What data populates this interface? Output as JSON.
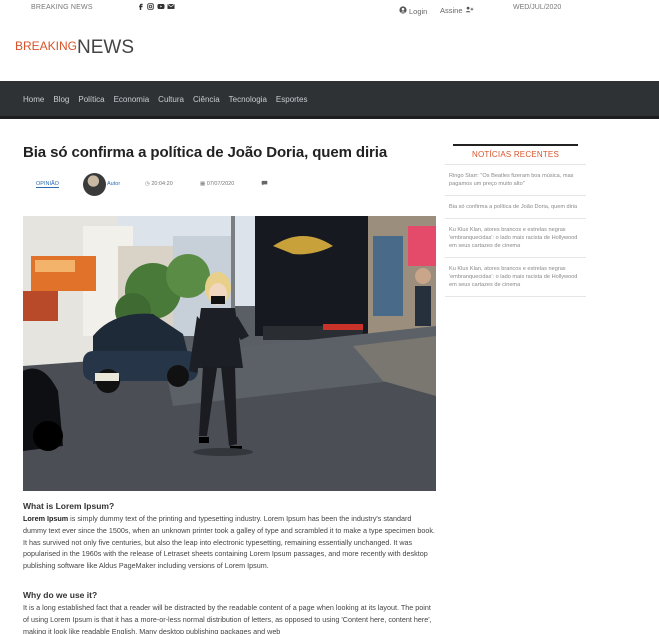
{
  "topbar": {
    "breaking": "BREAKING NEWS",
    "login": "Login",
    "subscribe": "Assine",
    "date": "WED/JUL/2020",
    "social_icons": [
      "facebook-icon",
      "instagram-icon",
      "youtube-icon",
      "envelope-icon"
    ]
  },
  "logo": {
    "part1": "BREAKING",
    "part2": "NEWS",
    "accent": "#d9532a"
  },
  "nav": {
    "items": [
      "Home",
      "Blog",
      "Política",
      "Economia",
      "Cultura",
      "Ciência",
      "Tecnologia",
      "Esportes"
    ]
  },
  "article": {
    "title": "Bia só confirma a política de João Doria, quem diria",
    "category": "OPINIÃO",
    "author": "Autor",
    "time": "20:04:20",
    "date": "07/07/2020",
    "h1": "What is Lorem Ipsum?",
    "p1_bold": "Lorem Ipsum",
    "p1": " is simply dummy text of the printing and typesetting industry. Lorem Ipsum has been the industry's standard dummy text ever since the 1500s, when an unknown printer took a galley of type and scrambled it to make a type specimen book. It has survived not only five centuries, but also the leap into electronic typesetting, remaining essentially unchanged. It was popularised in the 1960s with the release of Letraset sheets containing Lorem Ipsum passages, and more recently with desktop publishing software like Aldus PageMaker including versions of Lorem Ipsum.",
    "h2": "Why do we use it?",
    "p2": "It is a long established fact that a reader will be distracted by the readable content of a page when looking at its layout. The point of using Lorem Ipsum is that it has a more-or-less normal distribution of letters, as opposed to using 'Content here, content here', making it look like readable English. Many desktop publishing packages and web"
  },
  "sidebar": {
    "heading": "NOTÍCIAS RECENTES",
    "items": [
      "Ringo Starr: \"Os Beatles fizeram boa música, mas pagamos um preço muito alto\"",
      "Bia só confirma a política de João Doria, quem diria",
      "Ku Klux Klan, atores brancos e estrelas negras 'embranquecidas': o lado mais racista de Hollywood em seus cartazes de cinema",
      "Ku Klux Klan, atores brancos e estrelas negras 'embranquecidas': o lado mais racista de Hollywood em seus cartazes de cinema"
    ]
  }
}
